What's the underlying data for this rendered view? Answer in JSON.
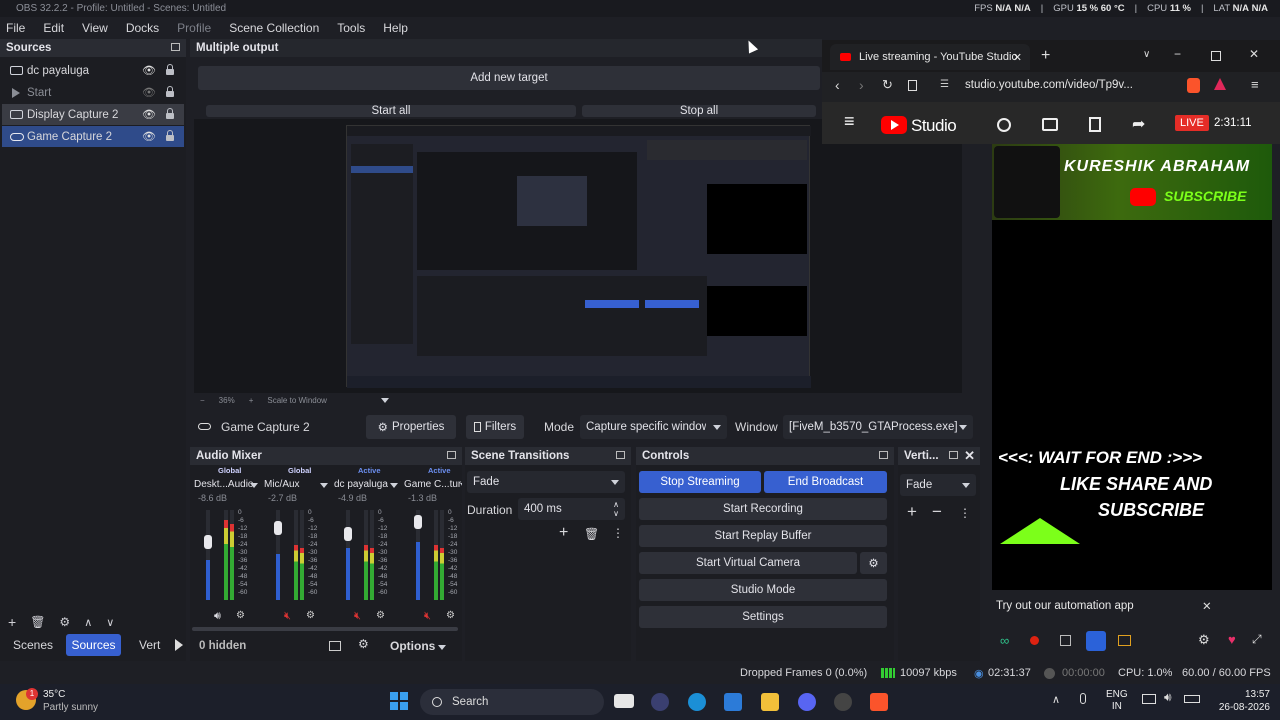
{
  "window": {
    "title": "OBS 32.2.2 - Profile: Untitled - Scenes: Untitled"
  },
  "stats": {
    "fps_label": "FPS",
    "fps_a": "N/A",
    "fps_b": "N/A",
    "gpu_label": "GPU",
    "gpu_val": "15 % 60 °C",
    "cpu_label": "CPU",
    "cpu_val": "11 %",
    "lat_label": "LAT",
    "lat_a": "N/A",
    "lat_b": "N/A"
  },
  "menu": {
    "file": "File",
    "edit": "Edit",
    "view": "View",
    "docks": "Docks",
    "profile": "Profile",
    "scene_collection": "Scene Collection",
    "tools": "Tools",
    "help": "Help"
  },
  "sources": {
    "title": "Sources",
    "items": [
      {
        "label": "dc payaluga"
      },
      {
        "label": "Start"
      },
      {
        "label": "Display Capture 2"
      },
      {
        "label": "Game Capture 2"
      }
    ]
  },
  "multi_output": {
    "title": "Multiple output",
    "add_target": "Add new target",
    "start_all": "Start all",
    "stop_all": "Stop all"
  },
  "preview": {
    "zoom": "36%",
    "scale": "Scale to Window"
  },
  "props_bar": {
    "source": "Game Capture 2",
    "properties": "Properties",
    "filters": "Filters",
    "mode_label": "Mode",
    "mode_value": "Capture specific window",
    "window_label": "Window",
    "window_value": "[FiveM_b3570_GTAProcess.exe]"
  },
  "audio_mixer": {
    "title": "Audio Mixer",
    "channels": [
      {
        "tag": "Global",
        "name": "Deskt...Audio",
        "db": "-8.6 dB"
      },
      {
        "tag": "Global",
        "name": "Mic/Aux",
        "db": "-2.7 dB"
      },
      {
        "tag": "Active",
        "name": "dc payaluga",
        "db": "-4.9 dB"
      },
      {
        "tag": "Active",
        "name": "Game C...ture",
        "db": "-1.3 dB"
      }
    ],
    "scale": [
      "0",
      "-6",
      "-12",
      "-18",
      "-24",
      "-30",
      "-36",
      "-42",
      "-48",
      "-54",
      "-60"
    ]
  },
  "scene_transitions": {
    "title": "Scene Transitions",
    "transition": "Fade",
    "duration_label": "Duration",
    "duration_value": "400 ms"
  },
  "controls": {
    "title": "Controls",
    "stop_streaming": "Stop Streaming",
    "end_broadcast": "End Broadcast",
    "start_recording": "Start Recording",
    "start_replay": "Start Replay Buffer",
    "start_virtual": "Start Virtual Camera",
    "studio_mode": "Studio Mode",
    "settings": "Settings"
  },
  "vertical": {
    "title": "Verti...",
    "transition": "Fade"
  },
  "bottom_tabs": {
    "scenes": "Scenes",
    "sources": "Sources",
    "vert": "Vert",
    "hidden": "0 hidden",
    "options": "Options"
  },
  "status": {
    "dropped": "Dropped Frames 0 (0.0%)",
    "kbps": "10097 kbps",
    "live_time": "02:31:37",
    "rec_time": "00:00:00",
    "cpu": "CPU: 1.0%",
    "fps": "60.00 / 60.00 FPS"
  },
  "browser": {
    "tab_title": "Live streaming - YouTube Studio",
    "url": "studio.youtube.com/video/Tp9v...",
    "studio_label": "Studio",
    "live_badge": "LIVE",
    "live_time": "2:31:11"
  },
  "overlay": {
    "channel_name": "KURESHIK ABRAHAM",
    "subscribe": "SUBSCRIBE",
    "line1": "<<<: WAIT FOR END :>>>",
    "line2": "LIKE SHARE AND",
    "line3": "SUBSCRIBE",
    "automation": "Try out our automation app"
  },
  "taskbar": {
    "weather_temp": "35°C",
    "weather_desc": "Partly sunny",
    "search": "Search",
    "lang": "ENG",
    "region": "IN",
    "time": "13:57",
    "date": "26-08-2026",
    "weather_badge": "1"
  },
  "colors": {
    "accent": "#3760d0",
    "live_red": "#e52d27",
    "overlay_green": "#7cff1a",
    "youtube_red": "#ff0000"
  }
}
